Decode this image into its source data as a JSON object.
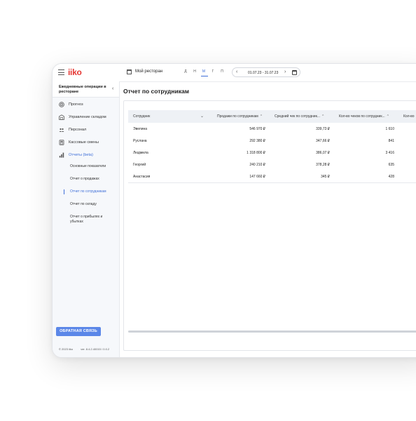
{
  "app": {
    "logo": "iiko",
    "store": "Мой ресторан",
    "periods": [
      "Д",
      "Н",
      "М",
      "Г",
      "П"
    ],
    "active_period": "М",
    "date_range": "01.07.23 - 31.07.23",
    "accent": "#3f6fd8",
    "logo_color": "#e53935"
  },
  "sidebar": {
    "header": "Ежедневные операции в ресторане",
    "items": [
      {
        "label": "Прогноз",
        "icon": "target-icon"
      },
      {
        "label": "Управление складом",
        "icon": "warehouse-icon"
      },
      {
        "label": "Персонал",
        "icon": "people-icon"
      },
      {
        "label": "Кассовые смены",
        "icon": "cash-register-icon"
      },
      {
        "label": "Отчеты (beta)",
        "icon": "bar-chart-icon"
      }
    ],
    "sub_items": [
      "Основные показатели",
      "Отчет о продажах",
      "Отчет по сотрудникам",
      "Отчет по складу",
      "Отчет о прибылях и убытках"
    ],
    "active_sub": "Отчет по сотрудникам",
    "feedback_button": "ОБРАТНАЯ СВЯЗЬ",
    "footer_copyright": "© 2023 iiko",
    "footer_version": "ver. 8.4.2.40015 / 0.0.2"
  },
  "main": {
    "title": "Отчет по сотрудникам",
    "columns": [
      "Сотрудник",
      "Продажи по сотрудникам",
      "Средний чек по сотрудник...",
      "Кол-во чеков по сотрудник...",
      "Кол-во"
    ],
    "rows": [
      {
        "name": "Эвелина",
        "sales": "546 970 ₽",
        "avg": "339,73 ₽",
        "count": "1 610"
      },
      {
        "name": "Руслана",
        "sales": "292 380 ₽",
        "avg": "347,66 ₽",
        "count": "841"
      },
      {
        "name": "Людмила",
        "sales": "1 318 800 ₽",
        "avg": "386,07 ₽",
        "count": "3 416"
      },
      {
        "name": "Георгий",
        "sales": "240 210 ₽",
        "avg": "378,28 ₽",
        "count": "635"
      },
      {
        "name": "Анастасия",
        "sales": "147 660 ₽",
        "avg": "345 ₽",
        "count": "428"
      }
    ]
  }
}
